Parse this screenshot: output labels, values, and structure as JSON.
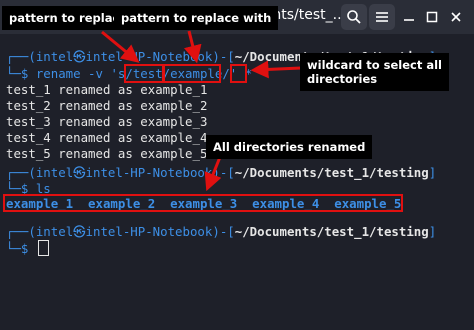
{
  "window": {
    "title": "ocuments/test_..."
  },
  "terminal": {
    "prompt1": {
      "user_host": "(intel㉿intel-HP-Notebook)",
      "path": "~/Documents/test_1/testing",
      "command": "rename -v 's/test/example/' *"
    },
    "output": [
      "test_1 renamed as example_1",
      "test_2 renamed as example_2",
      "test_3 renamed as example_3",
      "test_4 renamed as example_4",
      "test_5 renamed as example_5"
    ],
    "prompt2": {
      "user_host": "(intel㉿intel-HP-Notebook)",
      "path": "~/Documents/test_1/testing",
      "command": "ls"
    },
    "ls_output": "example_1  example_2  example_3  example_4  example_5",
    "prompt3": {
      "user_host": "(intel㉿intel-HP-Notebook)",
      "path": "~/Documents/test_1/testing"
    }
  },
  "annotations": {
    "pattern_to_replace": "pattern to replace",
    "pattern_to_replace_with": "pattern to replace with",
    "wildcard_line1": "wildcard to select all",
    "wildcard_line2": "directories",
    "all_renamed": "All directories renamed"
  },
  "colors": {
    "background": "#1e2029",
    "prompt_blue": "#3d8fe6",
    "annotation_red": "#e01010"
  }
}
